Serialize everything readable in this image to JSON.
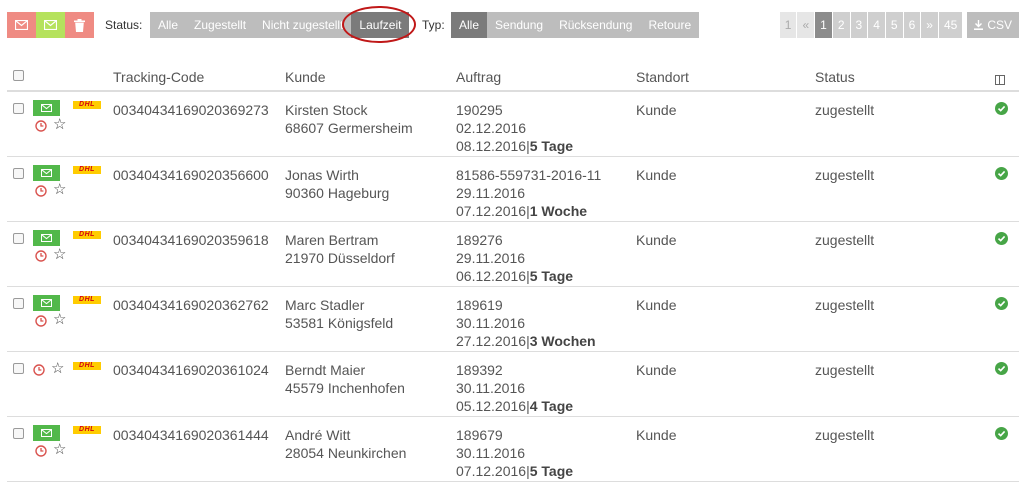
{
  "toolbar": {
    "status_label": "Status:",
    "status_filters": [
      "Alle",
      "Zugestellt",
      "Nicht zugestellt",
      "Laufzeit"
    ],
    "status_active": "Laufzeit",
    "typ_label": "Typ:",
    "typ_filters": [
      "Alle",
      "Sendung",
      "Rücksendung",
      "Retoure"
    ],
    "typ_active": "Alle",
    "pagination": [
      "1",
      "«",
      "1",
      "2",
      "3",
      "4",
      "5",
      "6",
      "»",
      "45"
    ],
    "csv_label": "CSV"
  },
  "columns": {
    "tracking": "Tracking-Code",
    "customer": "Kunde",
    "order": "Auftrag",
    "location": "Standort",
    "status": "Status"
  },
  "rows": [
    {
      "tracking": "00340434169020369273",
      "name": "Kirsten Stock",
      "city": "68607 Germersheim",
      "order_id": "190295",
      "date1": "02.12.2016",
      "date2": "08.12.2016",
      "duration": "5 Tage",
      "location": "Kunde",
      "status": "zugestellt"
    },
    {
      "tracking": "00340434169020356600",
      "name": "Jonas Wirth",
      "city": "90360 Hageburg",
      "order_id": "81586-559731-2016-11",
      "date1": "29.11.2016",
      "date2": "07.12.2016",
      "duration": "1 Woche",
      "location": "Kunde",
      "status": "zugestellt"
    },
    {
      "tracking": "00340434169020359618",
      "name": "Maren Bertram",
      "city": "21970 Düsseldorf",
      "order_id": "189276",
      "date1": "29.11.2016",
      "date2": "06.12.2016",
      "duration": "5 Tage",
      "location": "Kunde",
      "status": "zugestellt"
    },
    {
      "tracking": "00340434169020362762",
      "name": "Marc Stadler",
      "city": "53581 Königsfeld",
      "order_id": "189619",
      "date1": "30.11.2016",
      "date2": "27.12.2016",
      "duration": "3 Wochen",
      "location": "Kunde",
      "status": "zugestellt"
    },
    {
      "tracking": "00340434169020361024",
      "name": "Berndt Maier",
      "city": "45579 Inchenhofen",
      "order_id": "189392",
      "date1": "30.11.2016",
      "date2": "05.12.2016",
      "duration": "4 Tage",
      "location": "Kunde",
      "status": "zugestellt"
    },
    {
      "tracking": "00340434169020361444",
      "name": "André Witt",
      "city": "28054 Neunkirchen",
      "order_id": "189679",
      "date1": "30.11.2016",
      "date2": "07.12.2016",
      "duration": "5 Tage",
      "location": "Kunde",
      "status": "zugestellt"
    }
  ],
  "carrier_logo": "DHL",
  "colors": {
    "red": "#ef8b83",
    "green": "#52b84a",
    "lime": "#b5e25d",
    "ok": "#47a547",
    "highlight": "#c01818"
  }
}
